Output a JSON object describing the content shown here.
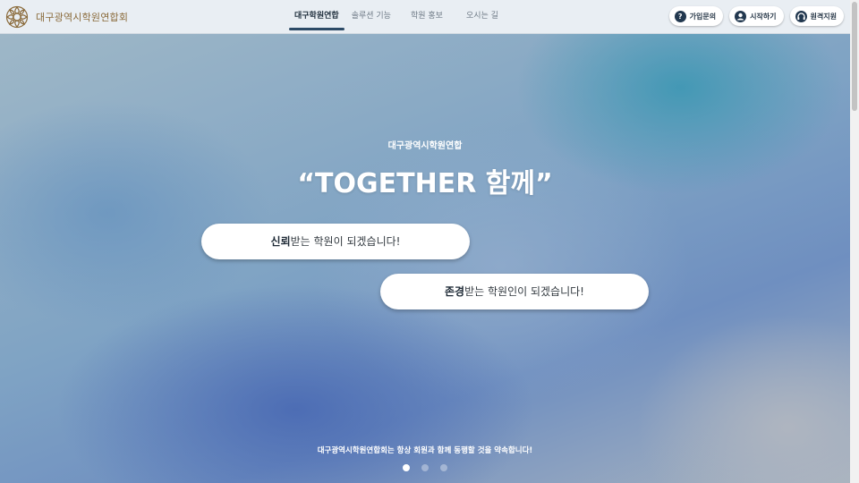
{
  "header": {
    "logo_text": "대구광역시학원연합회",
    "nav": [
      {
        "label": "대구학원연합",
        "active": true
      },
      {
        "label": "솔루션 기능",
        "active": false
      },
      {
        "label": "학원 홍보",
        "active": false
      },
      {
        "label": "오시는 길",
        "active": false
      }
    ],
    "buttons": [
      {
        "label": "가입문의",
        "icon": "question-icon",
        "glyph": "?"
      },
      {
        "label": "시작하기",
        "icon": "user-icon",
        "glyph": "●"
      },
      {
        "label": "원격지원",
        "icon": "headset-icon",
        "glyph": "♫"
      }
    ]
  },
  "hero": {
    "subtitle": "대구광역시학원연합",
    "title": "“TOGETHER 함께”",
    "pill1": {
      "bold": "신뢰",
      "rest": "받는 학원이 되겠습니다!"
    },
    "pill2": {
      "bold": "존경",
      "rest": "받는 학원인이 되겠습니다!"
    },
    "bottom_text": "대구광역시학원연합회는 항상 회원과 함께 동행할 것을 약속합니다!",
    "slides_total": 3,
    "active_slide": 1
  },
  "colors": {
    "accent": "#2c4a66",
    "logo": "#8a6a3a"
  }
}
